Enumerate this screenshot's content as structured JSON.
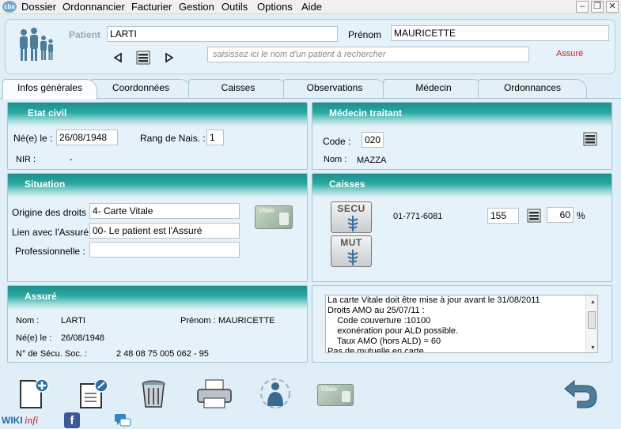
{
  "menu": {
    "logo": "cba",
    "items": [
      "Dossier",
      "Ordonnancier",
      "Facturier",
      "Gestion",
      "Outils",
      "Options",
      "Aide"
    ]
  },
  "window_controls": {
    "minimize": "–",
    "restore": "❐",
    "close": "✕"
  },
  "patient": {
    "label_patient": "Patient",
    "name": "LARTI",
    "label_prenom": "Prénom",
    "prenom": "MAURICETTE",
    "search_placeholder": "saisissez ici le nom d'un patient à rechercher",
    "status": "Assuré",
    "status_color": "#d42020"
  },
  "tabs": [
    "Infos générales",
    "Coordonnées",
    "Caisses",
    "Observations",
    "Médecin",
    "Ordonnances"
  ],
  "etat_civil": {
    "title": "Etat civil",
    "label_ne": "Né(e) le :",
    "ne": "26/08/1948",
    "label_rang": "Rang de Nais. :",
    "rang": "1",
    "label_nir": "NIR :",
    "nir": "-"
  },
  "medecin": {
    "title": "Médecin traitant",
    "label_code": "Code :",
    "code": "020",
    "label_nom": "Nom :",
    "nom": "MAZZA"
  },
  "situation": {
    "title": "Situation",
    "label_origine": "Origine des droits :",
    "origine": "4- Carte Vitale",
    "label_lien": "Lien avec l'Assuré :",
    "lien": "00- Le patient est l'Assuré",
    "label_pro": "Professionnelle :",
    "pro": "",
    "vitale_text": "Vitale"
  },
  "caisses": {
    "title": "Caisses",
    "secu_label": "SECU",
    "mut_label": "MUT",
    "numero": "01-771-6081",
    "code": "155",
    "taux": "60",
    "percent": "%"
  },
  "assure": {
    "title": "Assuré",
    "label_nom": "Nom :",
    "nom": "LARTI",
    "label_prenom": "Prénom :",
    "prenom": "MAURICETTE",
    "label_ne": "Né(e) le :",
    "ne": "26/08/1948",
    "label_secu": "N° de Sécu. Soc. :",
    "secu": "2 48 08 75 005 062 - 95"
  },
  "info_lines": [
    "La carte Vitale doit être mise à jour avant le 31/08/2011",
    "Droits AMO au 25/07/11 :",
    "    Code couverture :10100",
    "    exonération pour ALD possible.",
    "    Taux AMO (hors ALD) = 60",
    "Pas de mutuelle en carte"
  ],
  "footer": {
    "wiki": "WIKI",
    "infi": "infi"
  }
}
